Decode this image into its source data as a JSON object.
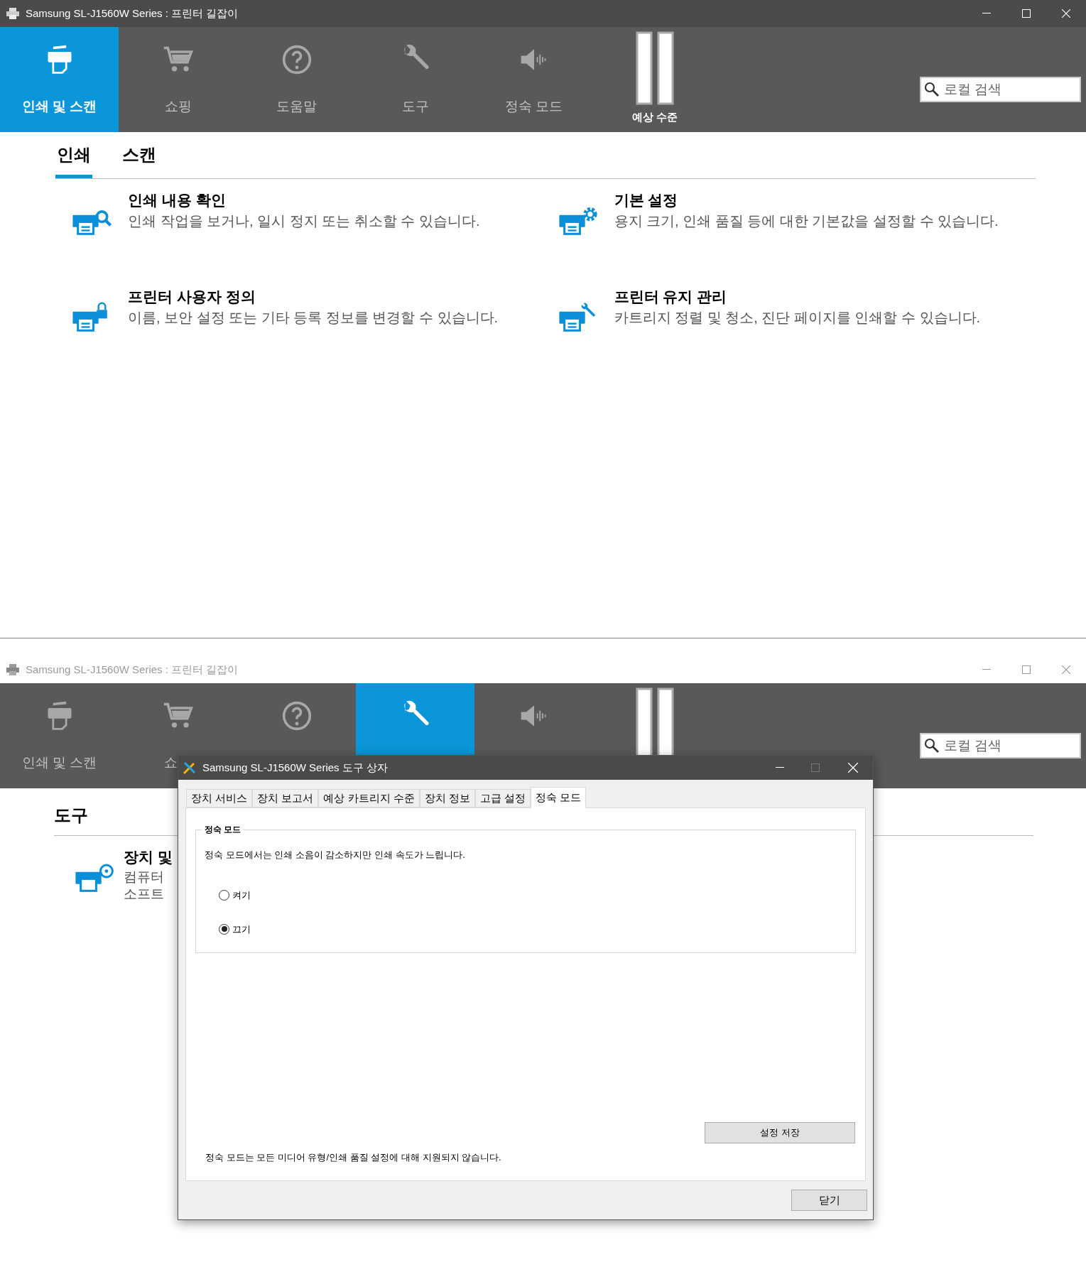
{
  "main_window": {
    "title": "Samsung SL-J1560W Series : 프린터 길잡이",
    "nav": [
      {
        "kind": "printer",
        "label": "인쇄 및 스캔",
        "selected": true
      },
      {
        "kind": "cart",
        "label": "쇼핑",
        "selected": false
      },
      {
        "kind": "help",
        "label": "도움말",
        "selected": false
      },
      {
        "kind": "wrench",
        "label": "도구",
        "selected": false
      },
      {
        "kind": "speaker",
        "label": "정숙 모드",
        "selected": false
      }
    ],
    "ink_label": "예상 수준",
    "search": {
      "placeholder": "로컬 검색"
    },
    "tabs": [
      {
        "label": "인쇄",
        "selected": true
      },
      {
        "label": "스캔",
        "selected": false
      }
    ],
    "items": [
      {
        "kind": "search",
        "title": "인쇄 내용 확인",
        "description": "인쇄 작업을 보거나, 일시 정지 또는 취소할 수 있습니다."
      },
      {
        "kind": "gear",
        "title": "기본 설정",
        "description": "용지 크기, 인쇄 품질 등에 대한 기본값을 설정할 수 있습니다."
      },
      {
        "kind": "lock",
        "title": "프린터 사용자 정의",
        "description": "이름, 보안 설정 또는 기타 등록 정보를 변경할 수 있습니다."
      },
      {
        "kind": "wrench",
        "title": "프린터 유지 관리",
        "description": "카트리지 정렬 및 청소, 진단 페이지를 인쇄할 수 있습니다."
      }
    ]
  },
  "back_window": {
    "title": "Samsung SL-J1560W Series : 프린터 길잡이",
    "nav": [
      {
        "kind": "printer",
        "label": "인쇄 및 스캔",
        "selected": false
      },
      {
        "kind": "cart",
        "label": "쇼",
        "selected": false
      },
      {
        "kind": "help",
        "selected": false
      },
      {
        "kind": "wrench",
        "selected": true
      },
      {
        "kind": "speaker",
        "selected": false
      }
    ],
    "search": {
      "placeholder": "로컬 검색"
    },
    "heading": "도구",
    "item": {
      "title": "장치 및",
      "lines": [
        "컴퓨터",
        "소프트"
      ]
    }
  },
  "dialog": {
    "title": "Samsung SL-J1560W Series 도구 상자",
    "tabs": [
      {
        "label": "장치 서비스",
        "selected": false
      },
      {
        "label": "장치 보고서",
        "selected": false
      },
      {
        "label": "예상 카트리지 수준",
        "selected": false
      },
      {
        "label": "장치 정보",
        "selected": false
      },
      {
        "label": "고급 설정",
        "selected": false
      },
      {
        "label": "정숙 모드",
        "selected": true
      }
    ],
    "group_title": "정숙 모드",
    "description": "정숙 모드에서는 인쇄 소음이 감소하지만 인쇄 속도가 느립니다.",
    "options": [
      {
        "label": "켜기",
        "selected": false
      },
      {
        "label": "끄기",
        "selected": true
      }
    ],
    "save_button": "설정 저장",
    "note": "정숙 모드는 모든 미디어 유형/인쇄 품질 설정에 대해 지원되지 않습니다.",
    "close_button": "닫기"
  }
}
